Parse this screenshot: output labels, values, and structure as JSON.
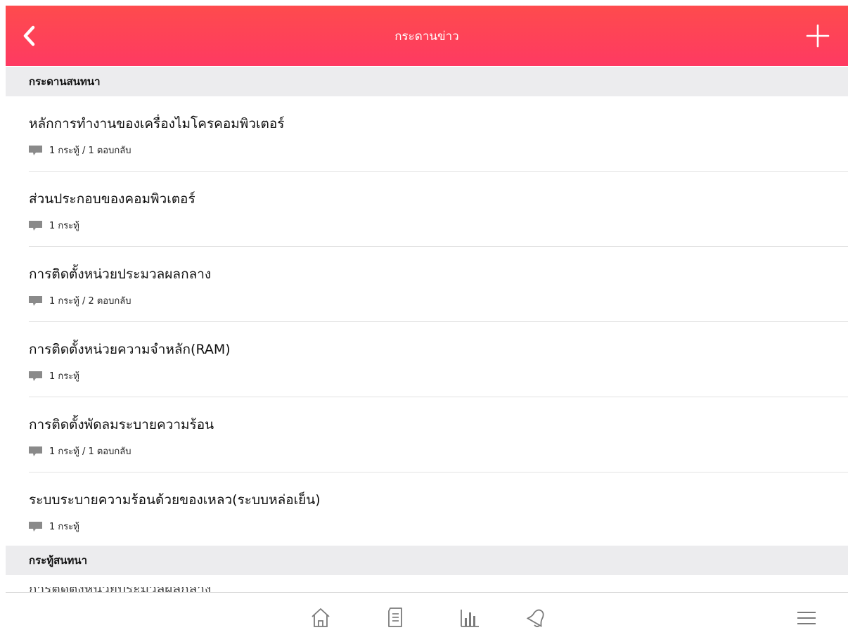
{
  "header": {
    "title": "กระดานข่าว",
    "back_icon": "chevron-left-icon",
    "add_icon": "plus-icon",
    "gradient": [
      "#fe4b4d",
      "#fe3a62"
    ]
  },
  "boards_section": {
    "title": "กระดานสนทนา",
    "items": [
      {
        "title": "หลักการทำงานของเครื่องไมโครคอมพิวเตอร์",
        "meta": "1 กระทู้ / 1 ตอบกลับ"
      },
      {
        "title": "ส่วนประกอบของคอมพิวเตอร์",
        "meta": "1 กระทู้"
      },
      {
        "title": "การติดตั้งหน่วยประมวลผลกลาง",
        "meta": "1 กระทู้ / 2 ตอบกลับ"
      },
      {
        "title": "การติดตั้งหน่วยความจำหลัก(RAM)",
        "meta": "1 กระทู้"
      },
      {
        "title": "การติดตั้งพัดลมระบายความร้อน",
        "meta": "1 กระทู้ / 1 ตอบกลับ"
      },
      {
        "title": "ระบบระบายความร้อนด้วยของเหลว(ระบบหล่อเย็น)",
        "meta": "1 กระทู้"
      }
    ]
  },
  "topics_section": {
    "title": "กระทู้สนทนา",
    "peek_text": "การติดตั้งหน่วยประมวลผลกลาง"
  },
  "bottom_nav": {
    "tabs": [
      "home-icon",
      "document-icon",
      "chart-icon",
      "bell-icon",
      "menu-icon"
    ]
  },
  "colors": {
    "accent": "#fe4159",
    "section_bg": "#ececee",
    "icon_gray": "#7a7a7a"
  }
}
